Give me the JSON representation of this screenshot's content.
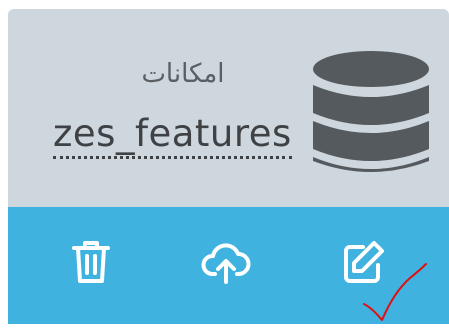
{
  "card": {
    "title_ar": "امکانات",
    "title_en": "zes_features",
    "icon": "database-icon",
    "colors": {
      "info_background": "#ced7dd",
      "actions_background": "#3fb2e0",
      "icon_color": "#555a5e",
      "action_icon_color": "#ffffff",
      "annotation_color": "#e01010"
    }
  },
  "actions": [
    {
      "name": "delete",
      "icon": "trash-icon"
    },
    {
      "name": "upload",
      "icon": "cloud-upload-icon"
    },
    {
      "name": "edit",
      "icon": "edit-icon"
    }
  ],
  "annotation": {
    "icon": "red-checkmark-annotation"
  }
}
